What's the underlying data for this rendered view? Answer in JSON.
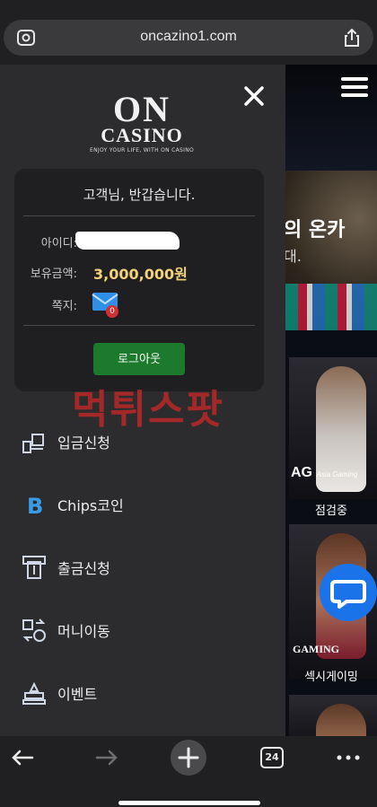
{
  "browser": {
    "url": "oncazino1.com",
    "tab_count": "24"
  },
  "drawer": {
    "logo_on": "ON",
    "logo_casino": "CASINO",
    "logo_tagline": "ENJOY YOUR LIFE, WITH ON CASINO",
    "greeting": "고객님, 반갑습니다.",
    "id_label": "아이디:",
    "balance_label": "보유금액:",
    "balance_value": "3,000,000원",
    "message_label": "쪽지:",
    "message_count": "0",
    "logout_label": "로그아웃",
    "menu": [
      {
        "label": "입금신청",
        "icon": "deposit-icon"
      },
      {
        "label": "Chips코인",
        "icon": "bitcoin-icon"
      },
      {
        "label": "출금신청",
        "icon": "withdraw-icon"
      },
      {
        "label": "머니이동",
        "icon": "money-transfer-icon"
      },
      {
        "label": "이벤트",
        "icon": "event-icon"
      }
    ]
  },
  "site": {
    "banner_title": "의 온카",
    "banner_sub": "대.",
    "card1_logo": "AG",
    "card1_logo_sub": "Asia Gaming",
    "card1_caption": "점검중",
    "card2_logo": "GAMING",
    "card2_caption": "섹시게이밍"
  },
  "watermark": "먹튀스팟",
  "colors": {
    "drawer_bg": "#2c2c2e",
    "card_bg": "#1f1f21",
    "balance": "#f3d27a",
    "logout_button": "#1b7a2b",
    "chat_button": "#1a73e8",
    "badge": "#d32f2f"
  }
}
